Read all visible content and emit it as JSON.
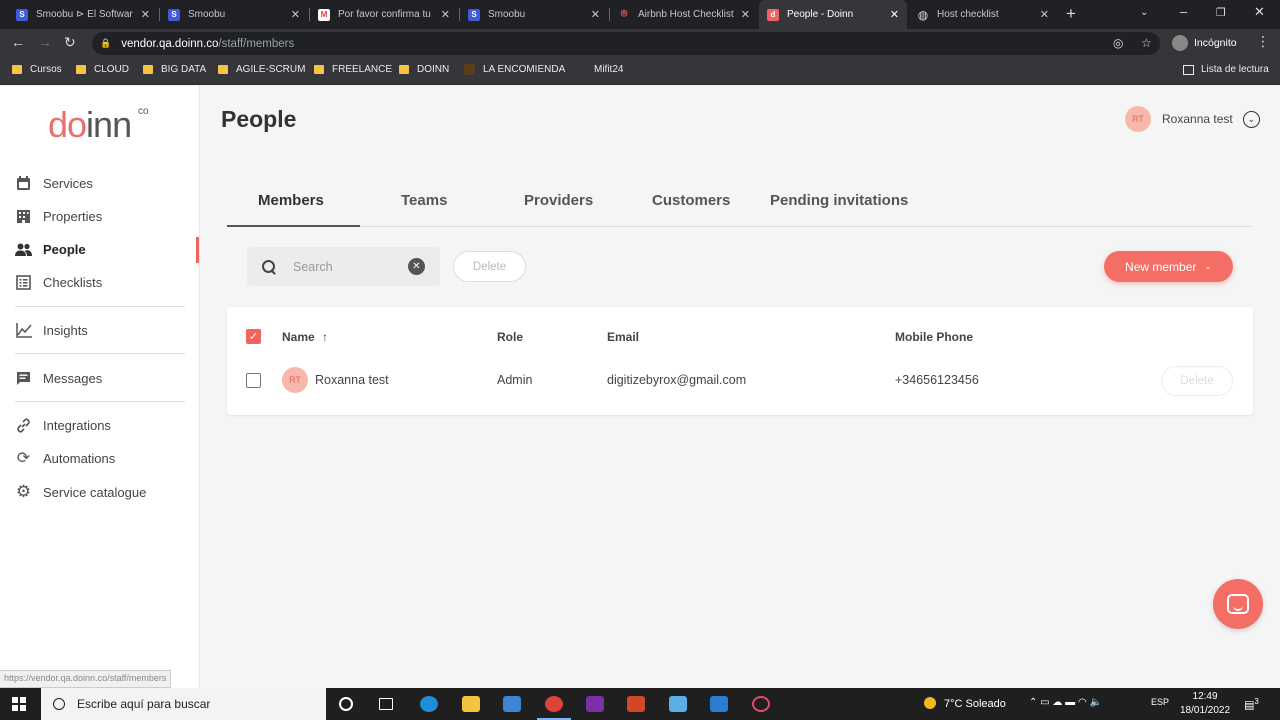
{
  "browser": {
    "tabs": [
      {
        "label": "Smoobu ⊳ El Softwar",
        "icon": "smoobu-icon",
        "color": "#3f5bd8",
        "glyph": "S"
      },
      {
        "label": "Smoobu",
        "icon": "smoobu-icon",
        "color": "#3f5bd8",
        "glyph": "S"
      },
      {
        "label": "Por favor confirma tu",
        "icon": "gmail-icon",
        "color": "#ea4335",
        "glyph": "M"
      },
      {
        "label": "Smoobu",
        "icon": "smoobu-icon",
        "color": "#3f5bd8",
        "glyph": "S"
      },
      {
        "label": "Airbnb Host Checklist",
        "icon": "airbnb-icon",
        "color": "#ff5a5f",
        "glyph": "⌾"
      },
      {
        "label": "People - Doinn",
        "icon": "doinn-icon",
        "color": "#f06460",
        "glyph": "d"
      },
      {
        "label": "Host checklist",
        "icon": "globe-icon",
        "color": "#888888",
        "glyph": "◍"
      }
    ],
    "url_host": "vendor.qa.doinn.co",
    "url_path": "/staff/members",
    "incognito_label": "Incógnito",
    "bookmarks": [
      "Cursos",
      "CLOUD",
      "BIG DATA",
      "AGILE-SCRUM",
      "FREELANCE",
      "DOINN",
      "LA ENCOMIENDA",
      "Mifit24"
    ],
    "reading_list": "Lista de lectura",
    "status_url": "https://vendor.qa.doinn.co/staff/members"
  },
  "brand": {
    "logo_a": "do",
    "logo_b": "inn",
    "logo_sup": "co",
    "accent": "#f06460"
  },
  "sidebar": {
    "items": [
      {
        "label": "Services",
        "icon": "calendar-icon"
      },
      {
        "label": "Properties",
        "icon": "building-icon"
      },
      {
        "label": "People",
        "icon": "people-icon"
      },
      {
        "label": "Checklists",
        "icon": "checklist-icon"
      },
      {
        "label": "Insights",
        "icon": "chart-line-icon"
      },
      {
        "label": "Messages",
        "icon": "message-icon"
      },
      {
        "label": "Integrations",
        "icon": "link-icon"
      },
      {
        "label": "Automations",
        "icon": "sync-icon"
      },
      {
        "label": "Service catalogue",
        "icon": "gear-icon"
      }
    ]
  },
  "header": {
    "title": "People",
    "user_initials": "RT",
    "user_name": "Roxanna test"
  },
  "tabs": [
    "Members",
    "Teams",
    "Providers",
    "Customers",
    "Pending invitations"
  ],
  "toolbar": {
    "search_placeholder": "Search",
    "delete_label": "Delete",
    "new_member_label": "New member"
  },
  "table": {
    "columns": [
      "Name",
      "Role",
      "Email",
      "Mobile Phone"
    ],
    "rows": [
      {
        "initials": "RT",
        "name": "Roxanna test",
        "role": "Admin",
        "email": "digitizebyrox@gmail.com",
        "phone": "+34656123456",
        "action": "Delete"
      }
    ]
  },
  "taskbar": {
    "search_placeholder": "Escribe aquí para buscar",
    "weather": "7°C  Soleado",
    "lang": "ESP",
    "time": "12:49",
    "date": "18/01/2022",
    "notif_count": "3"
  }
}
